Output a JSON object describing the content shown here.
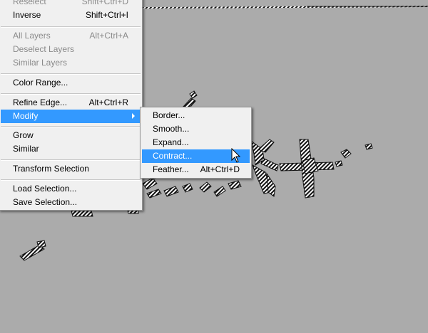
{
  "main_menu": {
    "items": [
      {
        "label": "Reselect",
        "shortcut": "Shift+Ctrl+D",
        "enabled": false
      },
      {
        "label": "Inverse",
        "shortcut": "Shift+Ctrl+I",
        "enabled": true
      },
      {
        "label": "All Layers",
        "shortcut": "Alt+Ctrl+A",
        "enabled": false
      },
      {
        "label": "Deselect Layers",
        "shortcut": "",
        "enabled": false
      },
      {
        "label": "Similar Layers",
        "shortcut": "",
        "enabled": false
      },
      {
        "label": "Color Range...",
        "shortcut": "",
        "enabled": true
      },
      {
        "label": "Refine Edge...",
        "shortcut": "Alt+Ctrl+R",
        "enabled": true
      },
      {
        "label": "Modify",
        "shortcut": "",
        "enabled": true,
        "highlighted": true,
        "submenu": true
      },
      {
        "label": "Grow",
        "shortcut": "",
        "enabled": true
      },
      {
        "label": "Similar",
        "shortcut": "",
        "enabled": true
      },
      {
        "label": "Transform Selection",
        "shortcut": "",
        "enabled": true
      },
      {
        "label": "Load Selection...",
        "shortcut": "",
        "enabled": true
      },
      {
        "label": "Save Selection...",
        "shortcut": "",
        "enabled": true
      }
    ]
  },
  "modify_submenu": {
    "items": [
      {
        "label": "Border...",
        "shortcut": ""
      },
      {
        "label": "Smooth...",
        "shortcut": ""
      },
      {
        "label": "Expand...",
        "shortcut": ""
      },
      {
        "label": "Contract...",
        "shortcut": "",
        "highlighted": true
      },
      {
        "label": "Feather...",
        "shortcut": "Alt+Ctrl+D"
      }
    ]
  },
  "colors": {
    "canvas": "#ababab",
    "menu_bg": "#f0f0f0",
    "highlight": "#3399ff",
    "disabled_text": "#8a8a8a"
  },
  "icons": {
    "pointer": "arrow-cursor-icon",
    "submenu_indicator": "submenu-arrow-icon"
  }
}
